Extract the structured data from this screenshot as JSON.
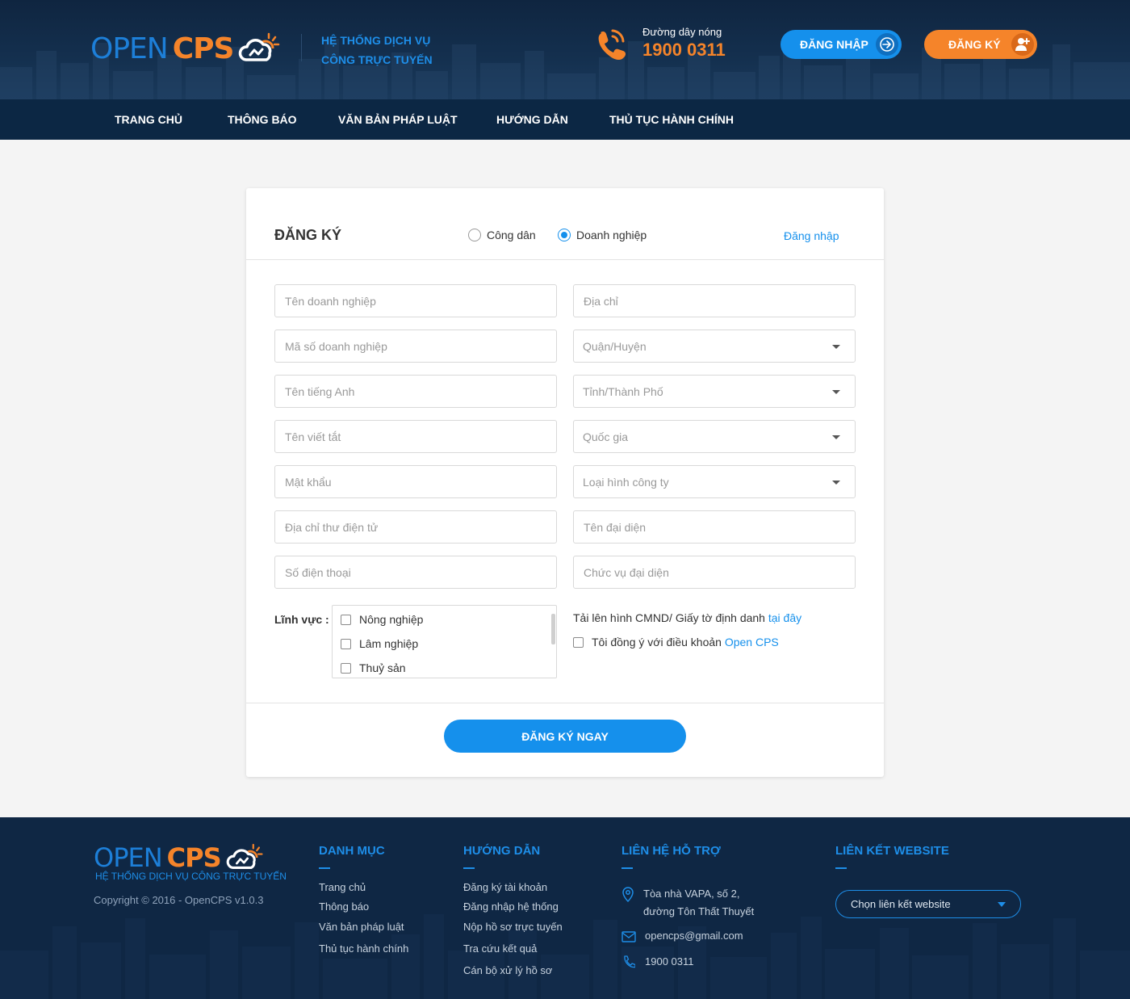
{
  "header": {
    "logo_open": "OPEN",
    "logo_cps": "CPS",
    "slogan_line1": "HỆ THỐNG DỊCH VỤ",
    "slogan_line2": "CÔNG TRỰC TUYẾN",
    "hotline_label": "Đường dây nóng",
    "hotline_number": "1900 0311",
    "login_label": "ĐĂNG NHẬP",
    "register_label": "ĐĂNG KÝ"
  },
  "nav": {
    "items": [
      {
        "label": "TRANG CHỦ"
      },
      {
        "label": "THÔNG BÁO"
      },
      {
        "label": "VĂN BẢN PHÁP LUẬT"
      },
      {
        "label": "HƯỚNG DẪN"
      },
      {
        "label": "THỦ TỤC HÀNH CHÍNH"
      }
    ]
  },
  "form": {
    "title": "ĐĂNG KÝ",
    "radio_citizen": "Công dân",
    "radio_business": "Doanh nghiệp",
    "radio_selected": "Doanh nghiệp",
    "login_link": "Đăng nhập",
    "left_fields": [
      "Tên doanh nghiệp",
      "Mã số doanh nghiệp",
      "Tên tiếng Anh",
      "Tên viết tắt",
      "Mật khẩu",
      "Địa chỉ thư điện tử",
      "Số điện thoại"
    ],
    "address_placeholder": "Địa chỉ",
    "district_placeholder": "Quận/Huyện",
    "province_placeholder": "Tỉnh/Thành Phố",
    "country_placeholder": "Quốc gia",
    "company_type_placeholder": "Loại hình công ty",
    "representative_placeholder": "Tên đại diện",
    "representative_position_placeholder": "Chức vụ đại diện",
    "field_label": "Lĩnh vực :",
    "field_options": [
      "Nông nghiệp",
      "Lâm nghiệp",
      "Thuỷ sản"
    ],
    "upload_text": "Tải lên hình CMND/ Giấy tờ định danh",
    "upload_link": "tại đây",
    "agree_text": "Tôi đồng ý với điều khoản",
    "agree_link": "Open CPS",
    "submit_label": "ĐĂNG KÝ NGAY"
  },
  "footer": {
    "logo_open": "OPEN",
    "logo_cps": "CPS",
    "slogan": "HỆ THỐNG DỊCH VỤ CÔNG TRỰC TUYẾN",
    "copyright": "Copyright © 2016 - OpenCPS v1.0.3",
    "col1_title": "DANH MỤC",
    "col1_links": [
      "Trang chủ",
      "Thông báo",
      "Văn bản pháp luật",
      "Thủ tục hành chính"
    ],
    "col2_title": "HƯỚNG DẪN",
    "col2_links": [
      "Đăng ký tài khoản",
      "Đăng nhập hệ thống",
      "Nộp hồ sơ trực tuyến",
      "Tra cứu kết quả",
      "Cán bộ xử lý hồ sơ"
    ],
    "col3_title": "LIÊN HỆ HỖ TRỢ",
    "address_line1": "Tòa nhà VAPA, số 2,",
    "address_line2": "đường Tôn Thất Thuyết",
    "email": "opencps@gmail.com",
    "phone": "1900 0311",
    "col4_title": "LIÊN KẾT WEBSITE",
    "website_select": "Chọn liên kết website"
  },
  "colors": {
    "primary_blue": "#1590ec",
    "accent_orange": "#f5842a",
    "header_dark": "#0f2540",
    "nav_dark": "#0c2744"
  }
}
